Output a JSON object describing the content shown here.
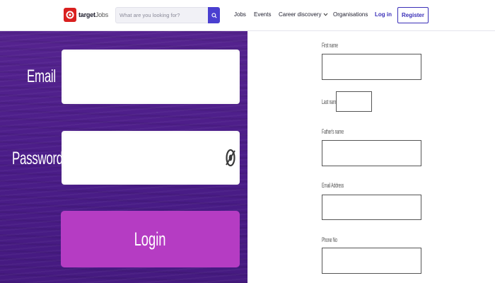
{
  "header": {
    "logo": {
      "brand": "target",
      "suffix": "Jobs"
    },
    "search": {
      "placeholder": "What are you looking for?"
    },
    "nav": {
      "jobs": "Jobs",
      "events": "Events",
      "career_discovery": "Career discovery",
      "organisations": "Organisations",
      "login": "Log in",
      "register": "Register"
    }
  },
  "login_panel": {
    "email_label": "Email",
    "password_label": "Password",
    "login_button": "Login"
  },
  "registration_form": {
    "first_name_label": "First name",
    "last_name_label": "Last name",
    "fathers_name_label": "Father's name",
    "email_label": "Email Address",
    "phone_label": "Phone No"
  },
  "colors": {
    "brand_red": "#d9201f",
    "accent_indigo": "#3a2fb8",
    "panel_purple": "#4b1d8a",
    "login_button": "#b53cc3"
  }
}
